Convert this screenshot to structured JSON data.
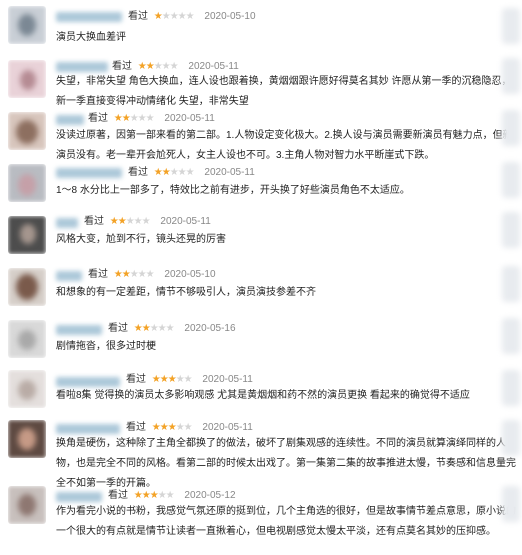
{
  "reviews": [
    {
      "label": "看过",
      "rating": 1,
      "date": "2020-05-10",
      "text": "演员大换血差评"
    },
    {
      "label": "看过",
      "rating": 2,
      "date": "2020-05-11",
      "text": "失望，非常失望 角色大换血，连人设也跟着换，黄烟烟跟许愿好得莫名其妙 许愿从第一季的沉稳隐忍，新一季直接变得冲动情绪化 失望，非常失望"
    },
    {
      "label": "看过",
      "rating": 2,
      "date": "2020-05-11",
      "text": "没读过原著，因第一部来看的第二部。1.人物设定变化极大。2.换人设与演员需要新演员有魅力点，但新演员没有。老一辈开会尬死人，女主人设也不可。3.主角人物对智力水平断崖式下跌。"
    },
    {
      "label": "看过",
      "rating": 2,
      "date": "2020-05-11",
      "text": "1～8 水分比上一部多了，特效比之前有进步，开头换了好些演员角色不太适应。"
    },
    {
      "label": "看过",
      "rating": 2,
      "date": "2020-05-11",
      "text": "风格大变，尬到不行，镜头还晃的厉害"
    },
    {
      "label": "看过",
      "rating": 2,
      "date": "2020-05-10",
      "text": "和想象的有一定差距，情节不够吸引人，演员演技参差不齐"
    },
    {
      "label": "看过",
      "rating": 2,
      "date": "2020-05-16",
      "text": "剧情拖沓，很多过时梗"
    },
    {
      "label": "看过",
      "rating": 3,
      "date": "2020-05-11",
      "text": "看啦8集 觉得换的演员太多影响观感 尤其是黄烟烟和药不然的演员更换 看起来的确觉得不适应"
    },
    {
      "label": "看过",
      "rating": 3,
      "date": "2020-05-11",
      "text": "换角是硬伤，这种除了主角全都换了的做法，破坏了剧集观感的连续性。不同的演员就算演绎同样的人物，也是完全不同的风格。看第二部的时候太出戏了。第一集第二集的故事推进太慢，节奏感和信息量完全不如第一季的开篇。"
    },
    {
      "label": "看过",
      "rating": 3,
      "date": "2020-05-12",
      "text": "作为看完小说的书粉，我感觉气氛还原的挺到位，几个主角选的很好，但是故事情节差点意思，原小说的一个很大的有点就是情节让读者一直揪着心，但电视剧感觉太慢太平淡，还有点莫名其妙的压抑感。"
    }
  ],
  "colors": {
    "star": "#f3a226",
    "star_empty": "#d5d5d5",
    "name_blur": "#9fbfd3"
  }
}
